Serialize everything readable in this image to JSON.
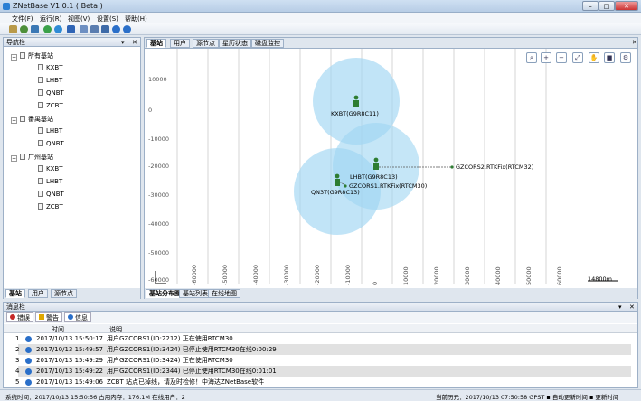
{
  "window": {
    "title": "ZNetBase V1.0.1 ( Beta )",
    "minimize": "–",
    "maximize": "□",
    "close": "✕"
  },
  "menu": [
    "文件(F)",
    "运行(R)",
    "视图(V)",
    "设置(S)",
    "帮助(H)"
  ],
  "toolbar": [
    "lock-icon",
    "user-icon",
    "user-add-icon",
    "play-icon",
    "stop-icon",
    "refresh-icon",
    "document-icon",
    "list-icon",
    "export-icon",
    "help-icon",
    "info-icon"
  ],
  "nav": {
    "title": "导航栏",
    "pin": "▾",
    "close": "✕",
    "groups": [
      {
        "label": "所有基站",
        "items": [
          "KXBT",
          "LHBT",
          "QNBT",
          "ZCBT"
        ]
      },
      {
        "label": "番禺基站",
        "items": [
          "LHBT",
          "QNBT"
        ]
      },
      {
        "label": "广州基站",
        "items": [
          "KXBT",
          "LHBT",
          "QNBT",
          "ZCBT"
        ]
      }
    ],
    "bottom_tabs": [
      "基站",
      "用户",
      "源节点"
    ]
  },
  "main": {
    "tabs": [
      "基站",
      "用户",
      "源节点",
      "星历状态",
      "磁盘监控"
    ],
    "close": "✕",
    "bottom_tabs": [
      "基站分布图",
      "基站列表",
      "在线地图"
    ],
    "map_tools": [
      "zoom-in-icon",
      "zoom-in-plus-icon",
      "zoom-out-icon",
      "fit-icon",
      "hand-icon",
      "square-icon",
      "settings-icon"
    ],
    "y_ticks": [
      "10000",
      "0",
      "-10000",
      "-20000",
      "-30000",
      "-40000",
      "-50000",
      "-60000"
    ],
    "x_ticks": [
      "-60000",
      "-50000",
      "-40000",
      "-30000",
      "-20000",
      "-10000",
      "0",
      "10000",
      "20000",
      "30000",
      "40000",
      "50000",
      "60000"
    ],
    "scale": "14800m",
    "stations": [
      {
        "label": "KXBT(G9R8C11)"
      },
      {
        "label": "LHBT(G9R8C13)"
      },
      {
        "label": "QN3T(G9R8C13)"
      }
    ],
    "users": [
      {
        "label": "GZCORS2.RTKFix(RTCM32)"
      },
      {
        "label": "GZCORS1.RTKFix(RTCM30)"
      }
    ]
  },
  "messages": {
    "title": "消息栏",
    "pin": "▾",
    "close": "✕",
    "filters": [
      {
        "label": "错误",
        "color": "#c62828"
      },
      {
        "label": "警告",
        "color": "#e0a800"
      },
      {
        "label": "信息",
        "color": "#2a6fc9"
      }
    ],
    "columns": [
      "时间",
      "说明"
    ],
    "rows": [
      {
        "n": "1",
        "time": "2017/10/13 15:50:17",
        "text": "用户GZCORS1(ID:2212) 正在使用RTCM30"
      },
      {
        "n": "2",
        "time": "2017/10/13 15:49:57",
        "text": "用户GZCORS1(ID:3424) 已停止使用RTCM30在线0:00:29"
      },
      {
        "n": "3",
        "time": "2017/10/13 15:49:29",
        "text": "用户GZCORS1(ID:3424) 正在使用RTCM30"
      },
      {
        "n": "4",
        "time": "2017/10/13 15:49:22",
        "text": "用户GZCORS1(ID:2344) 已停止使用RTCM30在线0:01:01"
      },
      {
        "n": "5",
        "time": "2017/10/13 15:49:06",
        "text": "ZCBT 站点已掉线，请及时检修！中海达ZNetBase软件"
      }
    ]
  },
  "status": {
    "left": "系统时间：2017/10/13 15:50:56   占用内存：176.1M   在线用户：2",
    "right": "当前历元：2017/10/13 07:50:58   GPST ▪ 自动更新时间 ▪ 更新时间"
  }
}
